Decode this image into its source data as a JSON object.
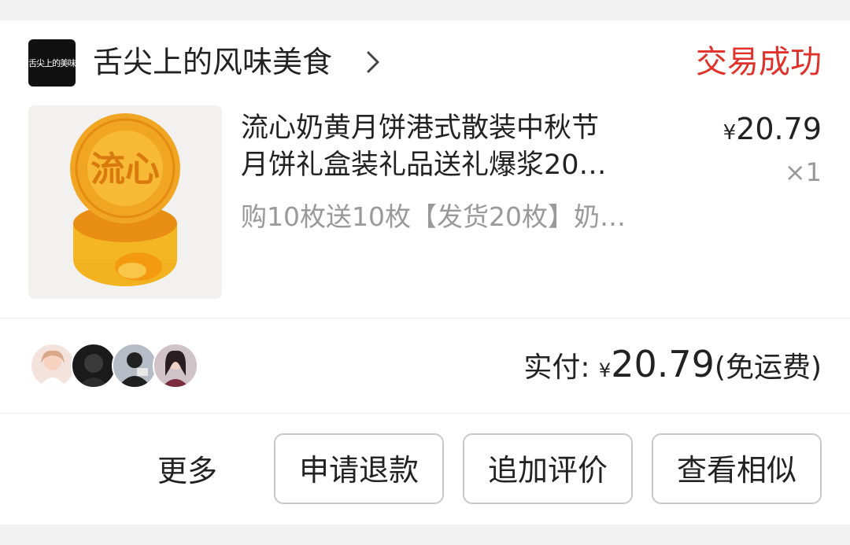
{
  "shop": {
    "name": "舌尖上的风味美食",
    "logo_text": "舌尖上的美味",
    "status": "交易成功"
  },
  "product": {
    "title_line1": "流心奶黄月饼港式散装中秋节",
    "title_line2": "月饼礼盒装礼品送礼爆浆20…",
    "sku": "购10枚送10枚【发货20枚】奶…",
    "currency": "¥",
    "price": "20.79",
    "quantity": "×1",
    "image_icon": "mooncake-image",
    "image_text": "流心"
  },
  "payment": {
    "label": "实付:",
    "currency": "¥",
    "amount": "20.79",
    "note": "(免运费)"
  },
  "actions": {
    "more": "更多",
    "refund": "申请退款",
    "review": "追加评价",
    "similar": "查看相似"
  },
  "colors": {
    "status": "#e0322b",
    "background": "#f2f2f2",
    "card": "#ffffff"
  }
}
